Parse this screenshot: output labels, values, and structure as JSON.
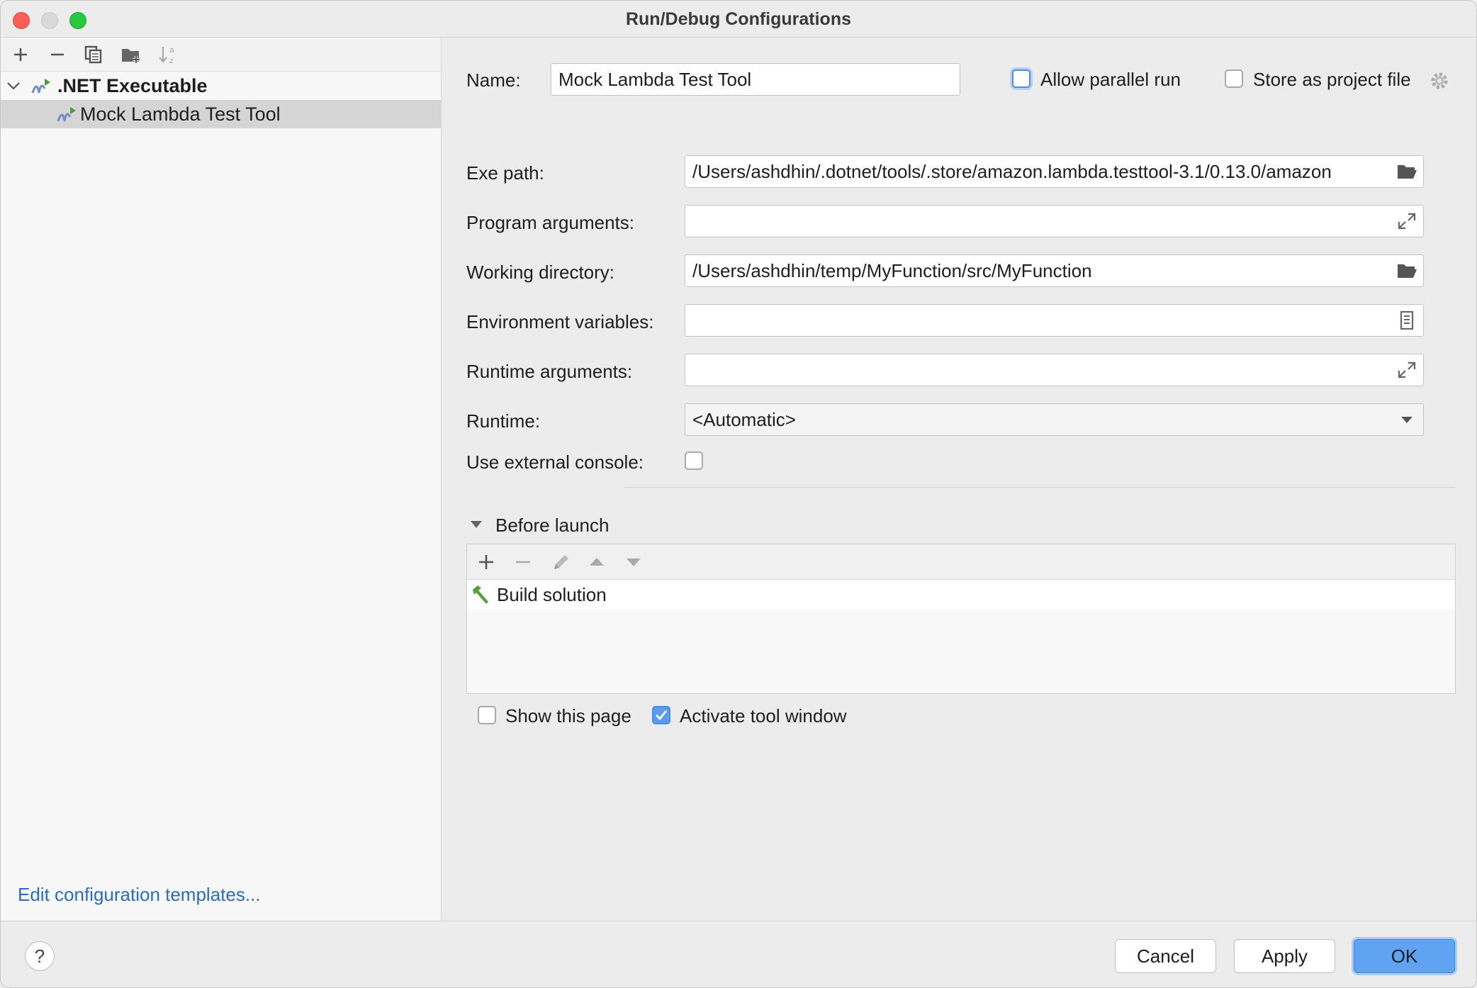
{
  "window": {
    "title": "Run/Debug Configurations"
  },
  "tree": {
    "group_label": ".NET Executable",
    "child_label": "Mock Lambda Test Tool",
    "edit_templates_link": "Edit configuration templates..."
  },
  "form": {
    "name_label": "Name:",
    "name_value": "Mock Lambda Test Tool",
    "allow_parallel_label": "Allow parallel run",
    "store_project_label": "Store as project file",
    "exe_path_label": "Exe path:",
    "exe_path_value": "/Users/ashdhin/.dotnet/tools/.store/amazon.lambda.testtool-3.1/0.13.0/amazon",
    "program_args_label": "Program arguments:",
    "program_args_value": "",
    "working_dir_label": "Working directory:",
    "working_dir_value": "/Users/ashdhin/temp/MyFunction/src/MyFunction",
    "env_vars_label": "Environment variables:",
    "env_vars_value": "",
    "runtime_args_label": "Runtime arguments:",
    "runtime_args_value": "",
    "runtime_label": "Runtime:",
    "runtime_value": "<Automatic>",
    "external_console_label": "Use external console:"
  },
  "before_launch": {
    "title": "Before launch",
    "tasks": [
      "Build solution"
    ],
    "show_page_label": "Show this page",
    "activate_tool_label": "Activate tool window"
  },
  "buttons": {
    "help": "?",
    "cancel": "Cancel",
    "apply": "Apply",
    "ok": "OK"
  },
  "colors": {
    "accent": "#5fa3f2",
    "link": "#2d6bbf",
    "selection": "#d5d5d5",
    "build_icon": "#5b9c3a"
  }
}
